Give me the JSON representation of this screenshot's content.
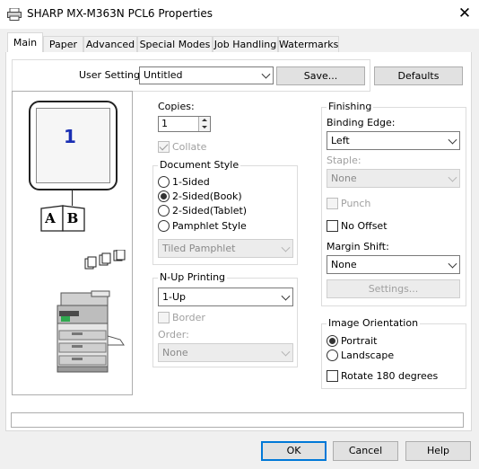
{
  "window": {
    "title": "SHARP MX-M363N PCL6 Properties"
  },
  "tabs": [
    {
      "label": "Main",
      "active": true
    },
    {
      "label": "Paper"
    },
    {
      "label": "Advanced"
    },
    {
      "label": "Special Modes"
    },
    {
      "label": "Job Handling"
    },
    {
      "label": "Watermarks"
    }
  ],
  "user_settings": {
    "label": "User Settings:",
    "value": "Untitled",
    "save_label": "Save...",
    "defaults_label": "Defaults"
  },
  "preview": {
    "page_number": "1",
    "booklet_left": "A",
    "booklet_right": "B"
  },
  "copies": {
    "label": "Copies:",
    "value": "1",
    "collate_label": "Collate"
  },
  "document_style": {
    "title": "Document Style",
    "options": [
      "1-Sided",
      "2-Sided(Book)",
      "2-Sided(Tablet)",
      "Pamphlet Style"
    ],
    "selected": "2-Sided(Book)",
    "pamphlet_value": "Tiled Pamphlet"
  },
  "nup": {
    "title": "N-Up Printing",
    "value": "1-Up",
    "border_label": "Border",
    "order_label": "Order:",
    "order_value": "None"
  },
  "finishing": {
    "title": "Finishing",
    "binding_label": "Binding Edge:",
    "binding_value": "Left",
    "staple_label": "Staple:",
    "staple_value": "None",
    "punch_label": "Punch",
    "no_offset_label": "No Offset",
    "margin_label": "Margin Shift:",
    "margin_value": "None",
    "settings_label": "Settings..."
  },
  "orientation": {
    "title": "Image Orientation",
    "options": [
      "Portrait",
      "Landscape"
    ],
    "selected": "Portrait",
    "rotate_label": "Rotate 180 degrees"
  },
  "footer": {
    "ok": "OK",
    "cancel": "Cancel",
    "help": "Help"
  },
  "colors": {
    "accent": "#0078d7",
    "preview_blue": "#1a2fb3"
  }
}
